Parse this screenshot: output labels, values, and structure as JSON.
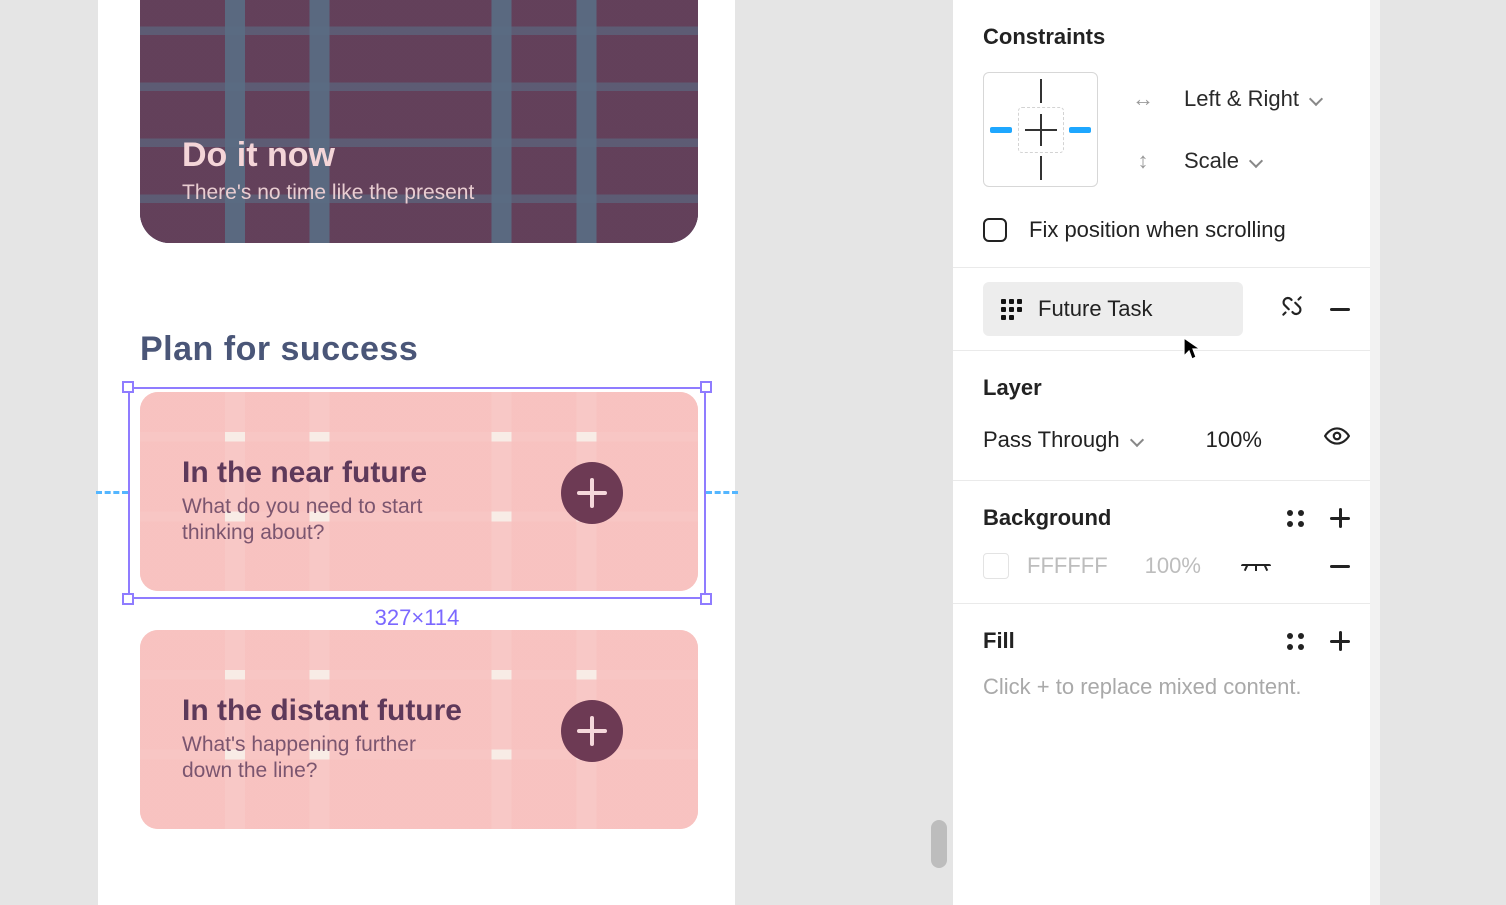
{
  "canvas": {
    "now_card": {
      "title": "Do it now",
      "subtitle": "There's no time like the present"
    },
    "section_title": "Plan for success",
    "future_cards": [
      {
        "title": "In the near future",
        "subtitle": "What do you need to start thinking about?"
      },
      {
        "title": "In the distant future",
        "subtitle": "What's happening further down the line?"
      }
    ],
    "selection_dimensions": "327×114"
  },
  "panel": {
    "constraints": {
      "title": "Constraints",
      "horizontal": "Left & Right",
      "vertical": "Scale",
      "fix_scroll_label": "Fix position when scrolling"
    },
    "component": {
      "name": "Future Task"
    },
    "layer": {
      "title": "Layer",
      "blend_mode": "Pass Through",
      "opacity": "100%"
    },
    "background": {
      "title": "Background",
      "hex": "FFFFFF",
      "opacity": "100%"
    },
    "fill": {
      "title": "Fill",
      "hint": "Click + to replace mixed content."
    }
  }
}
